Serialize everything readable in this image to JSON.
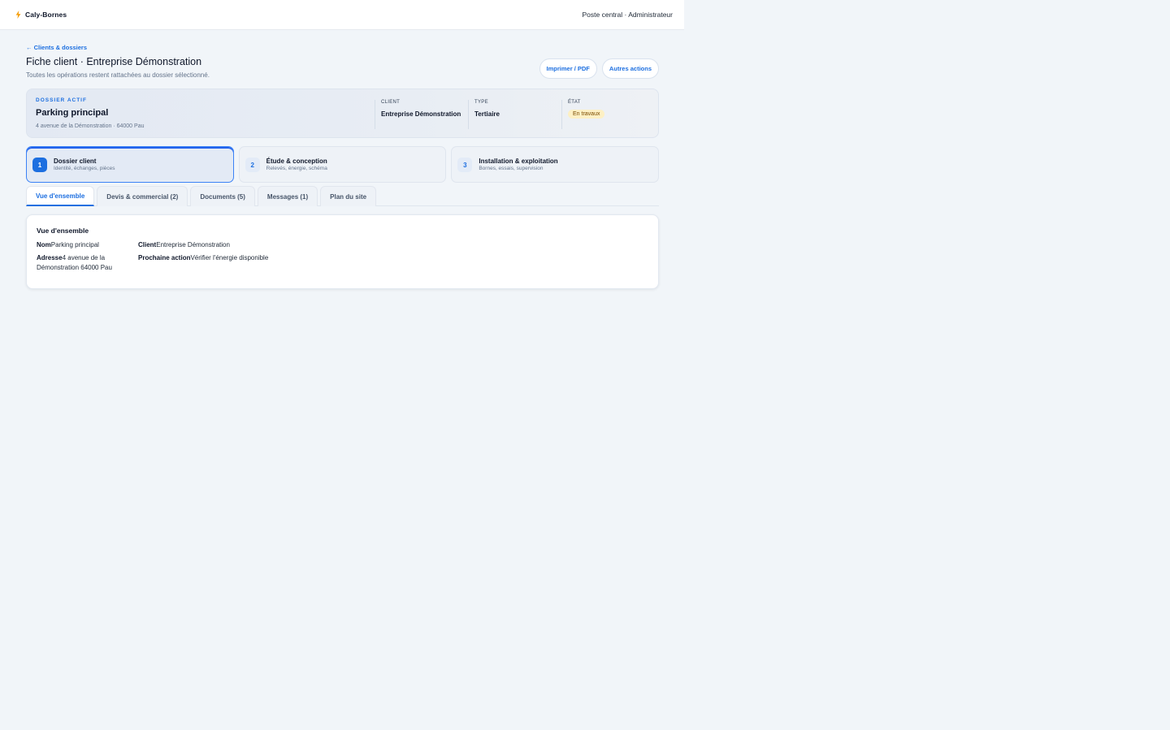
{
  "app": {
    "name": "Caly-Bornes",
    "user": "Poste central · Administrateur"
  },
  "colors": {
    "accent": "#1d6fe0",
    "background": "#f1f5f9",
    "brand_icon": "#f59e0b",
    "status_badge": "#fdf0c4"
  },
  "page": {
    "back_link": "← Clients & dossiers",
    "title": "Fiche client · Entreprise Démonstration",
    "subtitle": "Toutes les opérations restent rattachées au dossier sélectionné.",
    "actions": {
      "print": "Imprimer / PDF",
      "more": "Autres actions"
    }
  },
  "dossier": {
    "eyebrow": "DOSSIER ACTIF",
    "name": "Parking principal",
    "address": "4 avenue de la Démonstration · 64000 Pau",
    "client_label": "CLIENT",
    "client_value": "Entreprise Démonstration",
    "type_label": "TYPE",
    "type_value": "Tertiaire",
    "state_label": "ÉTAT",
    "state_value": "En travaux"
  },
  "steps": [
    {
      "num": "1",
      "title": "Dossier client",
      "subtitle": "Identité, échanges, pièces",
      "active": true
    },
    {
      "num": "2",
      "title": "Étude & conception",
      "subtitle": "Relevés, énergie, schéma",
      "active": false
    },
    {
      "num": "3",
      "title": "Installation & exploitation",
      "subtitle": "Bornes, essais, supervision",
      "active": false
    }
  ],
  "tabs": [
    {
      "label": "Vue d'ensemble",
      "active": true
    },
    {
      "label": "Devis & commercial (2)",
      "active": false
    },
    {
      "label": "Documents (5)",
      "active": false
    },
    {
      "label": "Messages (1)",
      "active": false
    },
    {
      "label": "Plan du site",
      "active": false
    }
  ],
  "overview": {
    "title": "Vue d'ensemble",
    "nom_label": "Nom",
    "nom_value": "Parking principal",
    "adresse_label": "Adresse",
    "adresse_value": "4 avenue de la Démonstration 64000 Pau",
    "client_label": "Client",
    "client_value": "Entreprise Démonstration",
    "action_label": "Prochaine action",
    "action_value": "Vérifier l'énergie disponible"
  }
}
